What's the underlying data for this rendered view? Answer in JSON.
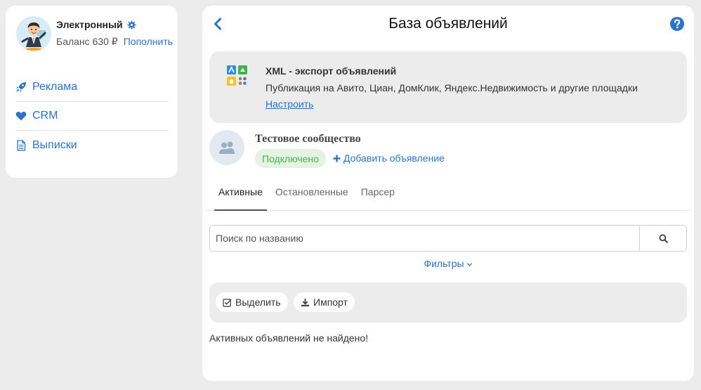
{
  "sidebar": {
    "profile": {
      "name": "Электронный",
      "balance_label": "Баланс 630 ₽",
      "topup_label": "Пополнить"
    },
    "menu": [
      {
        "label": "Реклама",
        "icon": "rocket-icon"
      },
      {
        "label": "CRM",
        "icon": "heart-icon"
      },
      {
        "label": "Выписки",
        "icon": "document-icon"
      }
    ]
  },
  "header": {
    "title": "База объявлений",
    "back_icon": "chevron-left-icon",
    "help_icon": "question-circle-icon"
  },
  "xml_export": {
    "title": "XML - экспорт объявлений",
    "description": "Публикация на Авито, Циан, ДомКлик, Яндекс.Недвижимость и другие площадки",
    "setup_label": "Настроить"
  },
  "community": {
    "name": "Тестовое сообщество",
    "status": "Подключено",
    "add_ad_label": "Добавить объявление"
  },
  "tabs": [
    {
      "label": "Активные",
      "active": true
    },
    {
      "label": "Остановленные",
      "active": false
    },
    {
      "label": "Парсер",
      "active": false
    }
  ],
  "search": {
    "placeholder": "Поиск по названию",
    "value": ""
  },
  "filters": {
    "label": "Фильтры"
  },
  "toolbar": {
    "select_label": "Выделить",
    "import_label": "Импорт"
  },
  "empty_message": "Активных объявлений не найдено!",
  "colors": {
    "accent": "#2a73c8",
    "background": "#ececec",
    "success": "#4caf50",
    "success_bg": "#e4f3e2"
  }
}
